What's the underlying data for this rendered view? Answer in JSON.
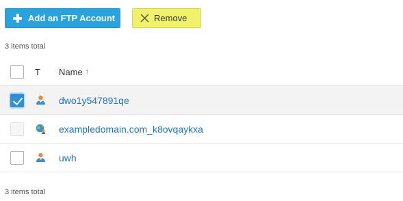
{
  "toolbar": {
    "add_label": "Add an FTP Account",
    "remove_label": "Remove"
  },
  "summary": {
    "top_total": "3 items total",
    "bottom_total": "3 items total"
  },
  "table": {
    "columns": {
      "type": "T",
      "name": "Name"
    },
    "sort": {
      "column": "Name",
      "direction": "ascending"
    },
    "rows": [
      {
        "name": "dwo1y547891qe",
        "type_icon": "user-icon",
        "checked": true,
        "disabled": false
      },
      {
        "name": "exampledomain.com_k8ovqaykxa",
        "type_icon": "globe-user-icon",
        "checked": false,
        "disabled": true
      },
      {
        "name": "uwh",
        "type_icon": "user-icon",
        "checked": false,
        "disabled": false
      }
    ]
  },
  "colors": {
    "primary": "#2aa2dc",
    "highlight": "#f1f26b",
    "link": "#1f74bf",
    "checkbox_checked": "#2f8fd6"
  }
}
